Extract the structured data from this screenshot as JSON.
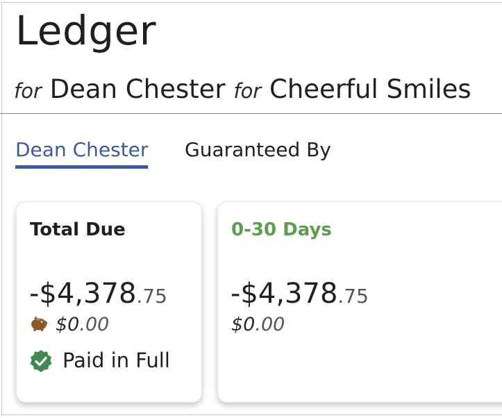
{
  "header": {
    "title": "Ledger",
    "for1": "for",
    "patient": "Dean Chester",
    "for2": "for",
    "practice": "Cheerful Smiles"
  },
  "tabs": [
    {
      "label": "Dean Chester",
      "active": true
    },
    {
      "label": "Guaranteed By",
      "active": false
    }
  ],
  "cards": [
    {
      "title": "Total Due",
      "amount_main": "-$4,378",
      "amount_cents": ".75",
      "sub_main": "$0",
      "sub_cents": ".00",
      "sub_icon": "piggy-bank-icon",
      "status_icon": "check-badge-icon",
      "status": "Paid in Full"
    },
    {
      "title": "0-30 Days",
      "amount_main": "-$4,378",
      "amount_cents": ".75",
      "sub_main": "$0",
      "sub_cents": ".00"
    }
  ],
  "colors": {
    "tab_active": "#3d5a9e",
    "aging_green": "#5b9e4d",
    "piggy_brown": "#8b5a2b",
    "check_green": "#3f8a52"
  }
}
